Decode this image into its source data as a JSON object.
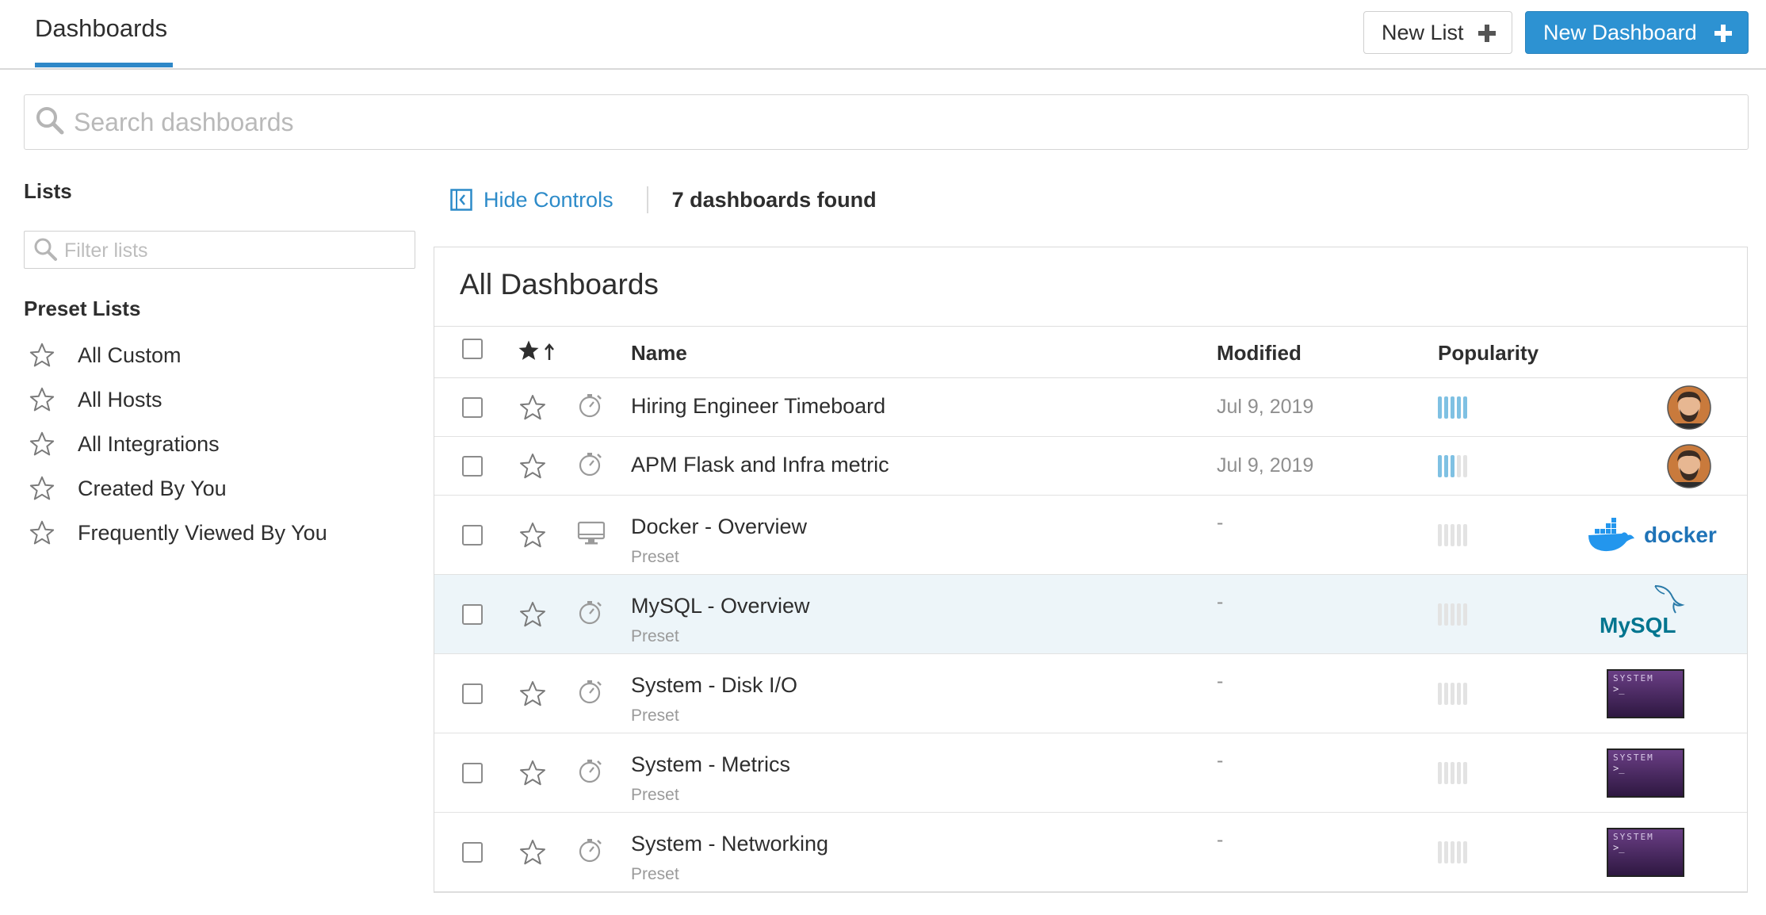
{
  "header": {
    "tab_label": "Dashboards",
    "new_list_label": "New List",
    "new_dashboard_label": "New Dashboard"
  },
  "search": {
    "placeholder": "Search dashboards"
  },
  "sidebar": {
    "lists_title": "Lists",
    "filter_placeholder": "Filter lists",
    "preset_title": "Preset Lists",
    "items": [
      {
        "label": "All Custom",
        "icon": "star-outline-icon"
      },
      {
        "label": "All Hosts",
        "icon": "star-outline-icon"
      },
      {
        "label": "All Integrations",
        "icon": "star-outline-icon"
      },
      {
        "label": "Created By You",
        "icon": "star-outline-icon"
      },
      {
        "label": "Frequently Viewed By You",
        "icon": "star-outline-icon"
      }
    ]
  },
  "controls": {
    "hide_controls_label": "Hide Controls",
    "found_text": "7 dashboards found"
  },
  "table": {
    "title": "All Dashboards",
    "columns": {
      "name": "Name",
      "modified": "Modified",
      "popularity": "Popularity"
    },
    "rows": [
      {
        "name": "Hiring Engineer Timeboard",
        "sub": "",
        "modified": "Jul 9, 2019",
        "popularity": 5,
        "type_icon": "timeboard-icon",
        "thumb": "avatar",
        "highlight": false
      },
      {
        "name": "APM Flask and Infra metric",
        "sub": "",
        "modified": "Jul 9, 2019",
        "popularity": 3,
        "type_icon": "timeboard-icon",
        "thumb": "avatar",
        "highlight": false
      },
      {
        "name": "Docker - Overview",
        "sub": "Preset",
        "modified": "-",
        "popularity": 0,
        "type_icon": "screenboard-icon",
        "thumb": "docker-logo",
        "highlight": false
      },
      {
        "name": "MySQL - Overview",
        "sub": "Preset",
        "modified": "-",
        "popularity": 0,
        "type_icon": "timeboard-icon",
        "thumb": "mysql-logo",
        "highlight": true
      },
      {
        "name": "System - Disk I/O",
        "sub": "Preset",
        "modified": "-",
        "popularity": 0,
        "type_icon": "timeboard-icon",
        "thumb": "system-terminal",
        "highlight": false
      },
      {
        "name": "System - Metrics",
        "sub": "Preset",
        "modified": "-",
        "popularity": 0,
        "type_icon": "timeboard-icon",
        "thumb": "system-terminal",
        "highlight": false
      },
      {
        "name": "System - Networking",
        "sub": "Preset",
        "modified": "-",
        "popularity": 0,
        "type_icon": "timeboard-icon",
        "thumb": "system-terminal",
        "highlight": false
      }
    ]
  },
  "logos": {
    "docker_text": "docker",
    "mysql_text": "MySQL",
    "system_text": "SYSTEM",
    "prompt_text": ">_"
  },
  "colors": {
    "accent": "#2d92d2",
    "link": "#2d8bc9",
    "popularity_on": "#7fc1e3",
    "highlight_row": "#edf5f9"
  }
}
